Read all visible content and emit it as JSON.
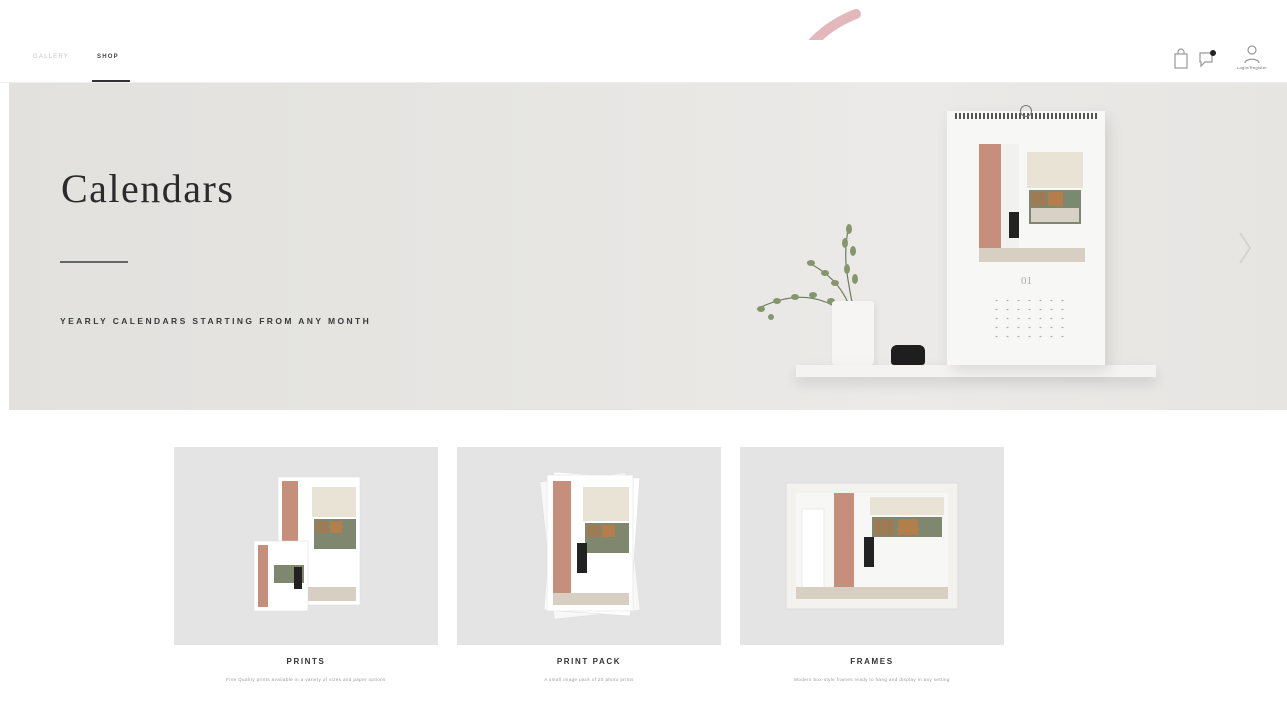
{
  "nav": {
    "tabs": [
      {
        "label": "GALLERY",
        "active": false
      },
      {
        "label": "SHOP",
        "active": true
      }
    ],
    "icons": [
      "cart-icon",
      "chat-icon",
      "account-icon"
    ],
    "account_label": "Login/Register"
  },
  "hero": {
    "title": "Calendars",
    "subtitle": "YEARLY CALENDARS STARTING FROM ANY MONTH",
    "calendar_month": "01",
    "next_icon": "chevron-right-icon"
  },
  "products": [
    {
      "title": "PRINTS",
      "description": "Fine Quality prints available in a variety of sizes and paper options"
    },
    {
      "title": "PRINT PACK",
      "description": "A small image pack of 20 photo prints"
    },
    {
      "title": "FRAMES",
      "description": "Modern box-style frames ready to hang and display in any setting"
    }
  ],
  "colors": {
    "accent_arrow": "#e3b8bd",
    "hero_bg": "#e6e5e2",
    "card_bg": "#e4e4e4",
    "text_dark": "#2b2b2b"
  }
}
